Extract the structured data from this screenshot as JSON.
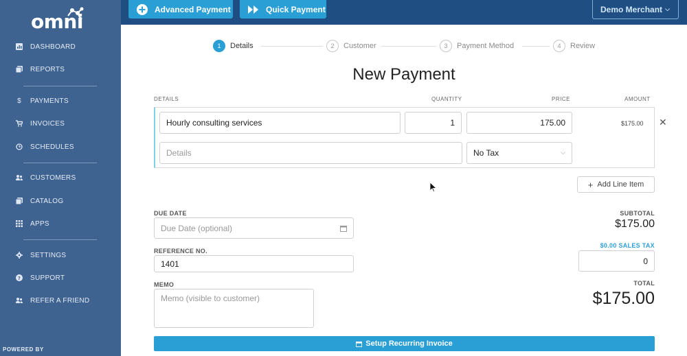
{
  "brand": {
    "logo_text": "omni",
    "powered_by": "POWERED BY"
  },
  "sidebar": {
    "items": [
      {
        "label": "DASHBOARD",
        "icon": "dashboard-icon"
      },
      {
        "label": "REPORTS",
        "icon": "reports-icon"
      },
      {
        "label": "PAYMENTS",
        "icon": "dollar-icon"
      },
      {
        "label": "INVOICES",
        "icon": "cart-icon"
      },
      {
        "label": "SCHEDULES",
        "icon": "clock-icon"
      },
      {
        "label": "CUSTOMERS",
        "icon": "users-icon"
      },
      {
        "label": "CATALOG",
        "icon": "catalog-icon"
      },
      {
        "label": "APPS",
        "icon": "apps-grid-icon"
      },
      {
        "label": "SETTINGS",
        "icon": "gear-icon"
      },
      {
        "label": "SUPPORT",
        "icon": "help-icon"
      },
      {
        "label": "REFER A FRIEND",
        "icon": "refer-icon"
      }
    ]
  },
  "topbar": {
    "advanced_payment": "Advanced Payment",
    "quick_payment": "Quick Payment",
    "merchant": "Demo Merchant"
  },
  "steps": [
    {
      "num": "1",
      "label": "Details",
      "active": true
    },
    {
      "num": "2",
      "label": "Customer",
      "active": false
    },
    {
      "num": "3",
      "label": "Payment Method",
      "active": false
    },
    {
      "num": "4",
      "label": "Review",
      "active": false
    }
  ],
  "page_title": "New Payment",
  "table": {
    "headers": {
      "details": "DETAILS",
      "quantity": "QUANTITY",
      "price": "PRICE",
      "amount": "AMOUNT"
    },
    "line_item": {
      "description": "Hourly consulting services",
      "quantity": "1",
      "price": "175.00",
      "amount": "$175.00",
      "details_placeholder": "Details",
      "tax": "No Tax"
    },
    "add_line_item": "Add Line Item"
  },
  "form": {
    "due_date_label": "DUE DATE",
    "due_date_placeholder": "Due Date (optional)",
    "reference_label": "REFERENCE NO.",
    "reference_value": "1401",
    "memo_label": "MEMO",
    "memo_placeholder": "Memo (visible to customer)"
  },
  "totals": {
    "subtotal_label": "SUBTOTAL",
    "subtotal_value": "$175.00",
    "sales_tax_label": "$0.00 SALES TAX",
    "sales_tax_value": "0",
    "total_label": "TOTAL",
    "total_value": "$175.00"
  },
  "recurring_button": "Setup Recurring Invoice",
  "colors": {
    "sidebar": "#3f6390",
    "topbar": "#1f4f82",
    "accent": "#2a9fd6"
  }
}
